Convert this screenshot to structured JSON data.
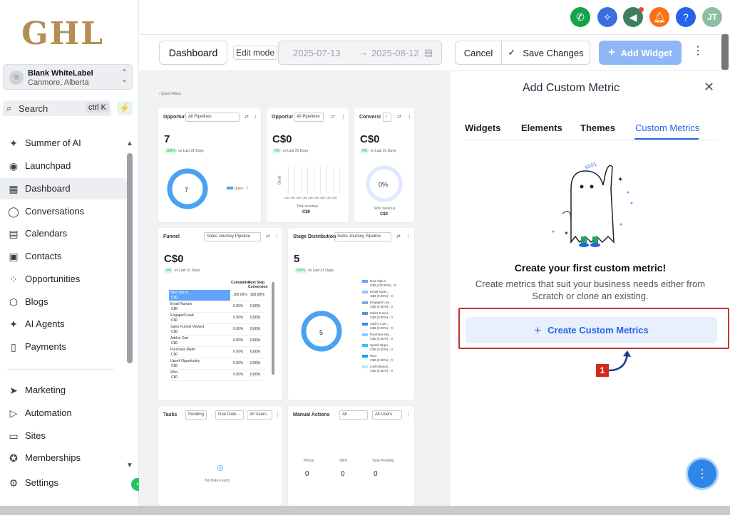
{
  "brand": {
    "logo_text": "GHL"
  },
  "account": {
    "name": "Blank WhiteLabel",
    "location": "Canmore, Alberta"
  },
  "search": {
    "label": "Search",
    "shortcut": "ctrl K"
  },
  "sidebar": {
    "items": [
      {
        "label": "Summer of AI",
        "icon": "sparkle-icon"
      },
      {
        "label": "Launchpad",
        "icon": "rocket-icon"
      },
      {
        "label": "Dashboard",
        "icon": "grid-icon"
      },
      {
        "label": "Conversations",
        "icon": "chat-bubble-icon"
      },
      {
        "label": "Calendars",
        "icon": "calendar-icon"
      },
      {
        "label": "Contacts",
        "icon": "contact-card-icon"
      },
      {
        "label": "Opportunities",
        "icon": "network-icon"
      },
      {
        "label": "Blogs",
        "icon": "box-icon"
      },
      {
        "label": "AI Agents",
        "icon": "sparkle-icon"
      },
      {
        "label": "Payments",
        "icon": "receipt-icon"
      }
    ],
    "items2": [
      {
        "label": "Marketing",
        "icon": "send-icon"
      },
      {
        "label": "Automation",
        "icon": "play-circle-icon"
      },
      {
        "label": "Sites",
        "icon": "browser-icon"
      },
      {
        "label": "Memberships",
        "icon": "award-icon"
      },
      {
        "label": "Settings",
        "icon": "gear-icon"
      }
    ]
  },
  "toolbar": {
    "dashboard_name": "Dashboard",
    "edit_mode": "Edit mode",
    "date_from": "2025-07-13",
    "date_to": "2025-08-12",
    "cancel": "Cancel",
    "save": "Save Changes",
    "add_widget": "Add Widget"
  },
  "canvas": {
    "quick_filters": "‹ Quick Filters",
    "opp1": {
      "title": "Opportur",
      "select": "All Pipelines",
      "value": "7",
      "chip": "100%",
      "chip_text": "vs Last 31 Days",
      "donut_value": "7",
      "legend": "Open - 7"
    },
    "opp2": {
      "title": "Opportur",
      "select": "All Pipelines",
      "value": "C$0",
      "chip": "0%",
      "chip_text": "vs Last 31 Days",
      "axis": "C$0 C$0 C$0 C$0 C$0 C$0 C$0 C$0 C$1",
      "ylabel": "Deals",
      "footer_label": "Total revenue",
      "footer_value": "C$0"
    },
    "conv": {
      "title": "Conversi",
      "value": "C$0",
      "chip": "0%",
      "chip_text": "vs Last 31 Days",
      "donut_value": "0%",
      "footer_label": "Won revenue",
      "footer_value": "C$0"
    },
    "funnel": {
      "title": "Funnel",
      "select": "Sales Journey Pipeline",
      "value": "C$0",
      "chip": "0%",
      "chip_text": "vs Last 31 Days",
      "col1": "Cumulative",
      "col2": "Next Step Conversion",
      "rows": [
        {
          "name": "New Opt-in",
          "value": "C$0",
          "a": "100.00%",
          "b": "100.00%"
        },
        {
          "name": "Email Nurture",
          "value": "C$0",
          "a": "0.00%",
          "b": "0.00%"
        },
        {
          "name": "Engaged Lead",
          "value": "C$0",
          "a": "0.00%",
          "b": "0.00%"
        },
        {
          "name": "Sales Funnel Viewed",
          "value": "C$0",
          "a": "0.00%",
          "b": "0.00%"
        },
        {
          "name": "Add to Cart",
          "value": "C$0",
          "a": "0.00%",
          "b": "0.00%"
        },
        {
          "name": "Purchase Made",
          "value": "C$0",
          "a": "0.00%",
          "b": "0.00%"
        },
        {
          "name": "Upsell Opportunity",
          "value": "C$0",
          "a": "0.00%",
          "b": "0.00%"
        },
        {
          "name": "Won",
          "value": "C$0",
          "a": "0.00%",
          "b": "0.00%"
        }
      ]
    },
    "stage": {
      "title": "Stage Distribution",
      "select": "Sales Journey Pipeline",
      "value": "5",
      "chip": "100%",
      "chip_text": "vs Last 31 Days",
      "donut_value": "5",
      "legend": [
        {
          "name": "New Opt-in",
          "sub": "C$0 (100.00%) - 5",
          "color": "#60a5fa"
        },
        {
          "name": "Email Nurtu...",
          "sub": "C$0 (0.00%) - 0",
          "color": "#93c5fd"
        },
        {
          "name": "Engaged Lea...",
          "sub": "C$0 (0.00%) - 0",
          "color": "#7aa7e8"
        },
        {
          "name": "Sales Funne...",
          "sub": "C$0 (0.00%) - 0",
          "color": "#5b8fd9"
        },
        {
          "name": "Add to Cart...",
          "sub": "C$0 (0.00%) - 0",
          "color": "#3b82f6"
        },
        {
          "name": "Purchase Ma...",
          "sub": "C$0 (0.00%) - 0",
          "color": "#7dd3fc"
        },
        {
          "name": "Upsell Oppo...",
          "sub": "C$0 (0.00%) - 0",
          "color": "#38bdf8"
        },
        {
          "name": "Won",
          "sub": "C$0 (0.00%) - 0",
          "color": "#0ea5e9"
        },
        {
          "name": "Lost/Abando...",
          "sub": "C$0 (0.00%) - 0",
          "color": "#bae6fd"
        }
      ]
    },
    "tasks": {
      "title": "Tasks",
      "sel1": "Pending",
      "sel2": "Due Date...",
      "sel3": "All Users",
      "empty": "No Data Found"
    },
    "manual": {
      "title": "Manual Actions",
      "sel1": "All",
      "sel2": "All Users",
      "c1": "Phone",
      "c2": "SMS",
      "c3": "Total Pending",
      "v1": "0",
      "v2": "0",
      "v3": "0"
    }
  },
  "panel": {
    "title": "Add Custom Metric",
    "tabs": [
      "Widgets",
      "Elements",
      "Themes",
      "Custom Metrics"
    ],
    "active_tab": "Custom Metrics",
    "heading": "Create your first custom metric!",
    "subtext": "Create metrics that suit your business needs either from Scratch or clone an existing.",
    "create_button": "Create Custom Metrics",
    "step": "1"
  },
  "colors": {
    "accent": "#2563eb",
    "highlight": "#c0342d",
    "brand_gold": "#b38f55",
    "green": "#16a34a"
  }
}
